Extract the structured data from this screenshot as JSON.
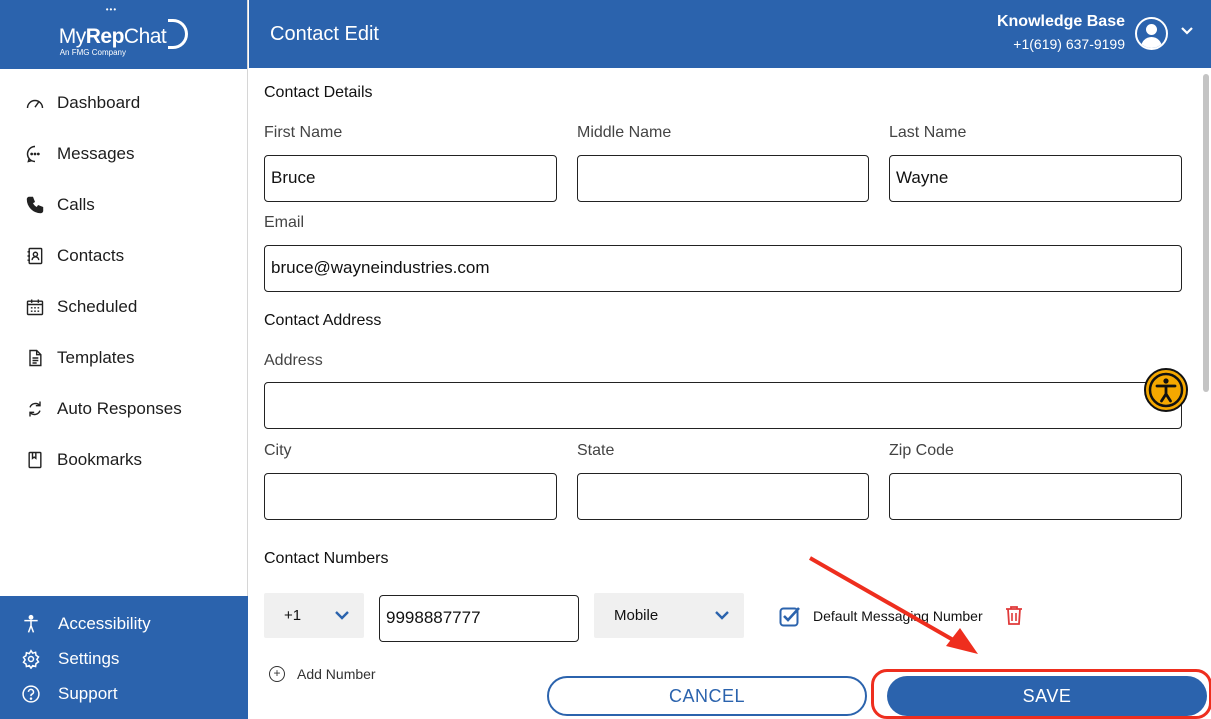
{
  "app": {
    "logo_my": "My",
    "logo_rep": "Rep",
    "logo_chat": "Chat",
    "logo_dots": "•••",
    "logo_sub": "An FMG Company"
  },
  "header": {
    "title": "Contact Edit",
    "account_name": "Knowledge Base",
    "account_phone": "+1(619) 637-9199"
  },
  "sidebar": {
    "items": [
      {
        "label": "Dashboard",
        "icon": "gauge-icon"
      },
      {
        "label": "Messages",
        "icon": "chat-bubble-icon"
      },
      {
        "label": "Calls",
        "icon": "phone-icon"
      },
      {
        "label": "Contacts",
        "icon": "contact-card-icon"
      },
      {
        "label": "Scheduled",
        "icon": "calendar-icon"
      },
      {
        "label": "Templates",
        "icon": "document-icon"
      },
      {
        "label": "Auto Responses",
        "icon": "refresh-icon"
      },
      {
        "label": "Bookmarks",
        "icon": "bookmark-icon"
      }
    ],
    "bottom": [
      {
        "label": "Accessibility",
        "icon": "accessibility-icon"
      },
      {
        "label": "Settings",
        "icon": "gear-icon"
      },
      {
        "label": "Support",
        "icon": "help-icon"
      }
    ]
  },
  "form": {
    "details_title": "Contact Details",
    "first_name_label": "First Name",
    "first_name_value": "Bruce",
    "middle_name_label": "Middle Name",
    "middle_name_value": "",
    "last_name_label": "Last Name",
    "last_name_value": "Wayne",
    "email_label": "Email",
    "email_value": "bruce@wayneindustries.com",
    "address_title": "Contact Address",
    "address_label": "Address",
    "address_value": "",
    "city_label": "City",
    "city_value": "",
    "state_label": "State",
    "state_value": "",
    "zip_label": "Zip Code",
    "zip_value": "",
    "numbers_title": "Contact Numbers",
    "country_code": "+1",
    "phone_value": "9998887777",
    "phone_type": "Mobile",
    "default_label": "Default Messaging Number",
    "default_checked": true,
    "add_number_label": "Add Number"
  },
  "actions": {
    "cancel_label": "CANCEL",
    "save_label": "SAVE"
  },
  "colors": {
    "brand": "#2b63ad",
    "highlight": "#ee2e1e",
    "accessibility_badge": "#f5a800",
    "delete": "#e03a3a"
  }
}
